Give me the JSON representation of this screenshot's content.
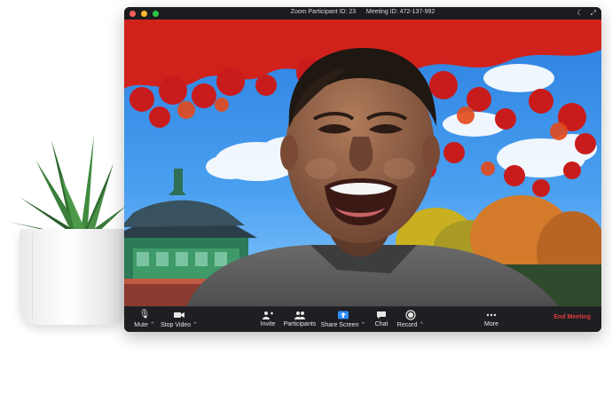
{
  "window": {
    "title_participant": "Zoom Participant ID: 23",
    "title_meeting": "Meeting ID: 472-137-992"
  },
  "toolbar": {
    "mute": "Mute",
    "stop_video": "Stop Video",
    "invite": "Invite",
    "participants": "Participants",
    "share_screen": "Share Screen",
    "chat": "Chat",
    "record": "Record",
    "more": "More",
    "end_meeting": "End Meeting"
  },
  "icons": {
    "mute": "microphone-icon",
    "stop_video": "video-camera-icon",
    "invite": "add-user-icon",
    "participants": "participants-icon",
    "share_screen": "share-screen-icon",
    "chat": "chat-icon",
    "record": "record-icon",
    "more": "more-icon",
    "dark_mode": "moon-icon",
    "fullscreen": "fullscreen-icon"
  },
  "colors": {
    "window_background": "#111111",
    "toolbar_background": "#1d1f22",
    "share_accent": "#2d8cff",
    "end_meeting": "#e13c3c",
    "traffic_close": "#ff5f57",
    "traffic_minimize": "#febc2e",
    "traffic_zoom": "#28c840"
  }
}
